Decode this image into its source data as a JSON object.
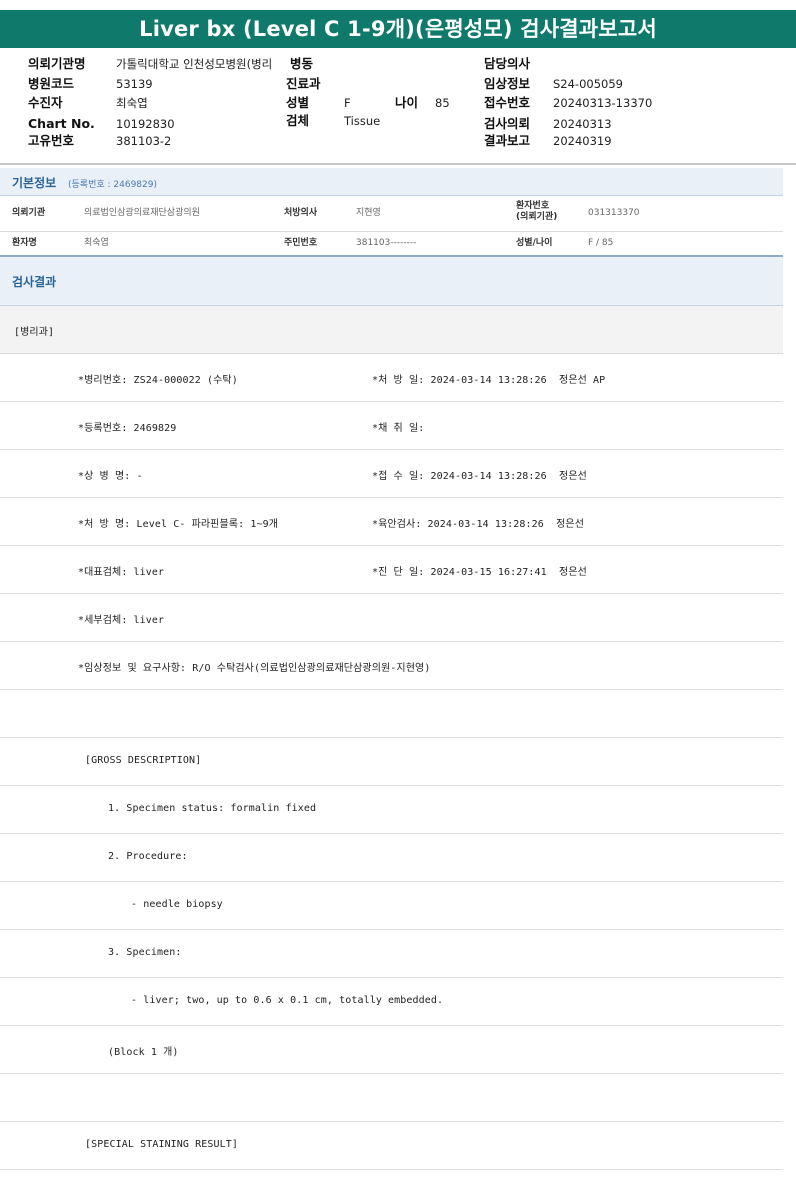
{
  "report": {
    "title": "Liver bx (Level C 1-9개)(은평성모) 검사결과보고서"
  },
  "header": {
    "institution_label": "의뢰기관명",
    "institution_value": "가톨릭대학교 인천성모병원(병리",
    "ward_label": "병동",
    "doctor_label": "담당의사",
    "hospital_code_label": "병원코드",
    "hospital_code_value": "53139",
    "department_label": "진료과",
    "clinical_info_label": "임상정보",
    "clinical_info_value": "S24-005059",
    "patient_label": "수진자",
    "patient_value": "최숙엽",
    "sex_label": "성별",
    "sex_value": "F",
    "age_label": "나이",
    "age_value": "85",
    "receipt_label": "접수번호",
    "receipt_value": "20240313-13370",
    "chart_label": "Chart No.",
    "chart_value": "10192830",
    "specimen_label": "검체",
    "specimen_value": "Tissue",
    "request_label": "검사의뢰",
    "request_value": "20240313",
    "unique_label": "고유번호",
    "unique_value": "381103-2",
    "result_date_label": "결과보고",
    "result_date_value": "20240319"
  },
  "basic_info": {
    "title": "기본정보",
    "reg_no": "(등록번호 : 2469829)",
    "rows": [
      {
        "l1": "의뢰기관",
        "v1": "의료법인삼광의료재단삼광의원",
        "l2": "처방의사",
        "v2": "지현영",
        "l3": "환자번호\n(의뢰기관)",
        "v3": "031313370"
      },
      {
        "l1": "환자명",
        "v1": "최숙엽",
        "l2": "주민번호",
        "v2": "381103--------",
        "l3": "성별/나이",
        "v3": "F / 85"
      }
    ]
  },
  "results": {
    "title": "검사결과",
    "dept": "[병리과]",
    "lines": [
      {
        "left": "*병리번호: ZS24-000022 (수탁)",
        "right": "*처 방 일: 2024-03-14 13:28:26  정은선 AP"
      },
      {
        "left": "*등록번호: 2469829",
        "right": "*채 취 일:"
      },
      {
        "left": "*상 병 명: -",
        "right": "*접 수 일: 2024-03-14 13:28:26  정은선"
      },
      {
        "left": "*처 방 명: Level C- 파라핀블록: 1~9개",
        "right": "*육안검사: 2024-03-14 13:28:26  정은선"
      },
      {
        "left": "*대표검체: liver",
        "right": "*진 단 일: 2024-03-15 16:27:41  정은선"
      },
      {
        "left": "*세부검체: liver",
        "right": ""
      },
      {
        "left": "*임상정보 및 요구사항: R/O 수탁검사(의료법인삼광의료재단삼광의원-지현영)",
        "right": ""
      }
    ],
    "gross": [
      {
        "indent": 0,
        "text": ""
      },
      {
        "indent": 1,
        "text": "[GROSS DESCRIPTION]"
      },
      {
        "indent": 2,
        "text": "1. Specimen status: formalin fixed"
      },
      {
        "indent": 2,
        "text": "2. Procedure:"
      },
      {
        "indent": 3,
        "text": "- needle biopsy"
      },
      {
        "indent": 2,
        "text": "3. Specimen:"
      },
      {
        "indent": 3,
        "text": "- liver; two, up to 0.6 x 0.1 cm, totally embedded."
      },
      {
        "indent": 2,
        "text": "(Block 1 개)"
      },
      {
        "indent": 0,
        "text": ""
      },
      {
        "indent": 1,
        "text": "[SPECIAL STAINING RESULT]"
      }
    ]
  }
}
